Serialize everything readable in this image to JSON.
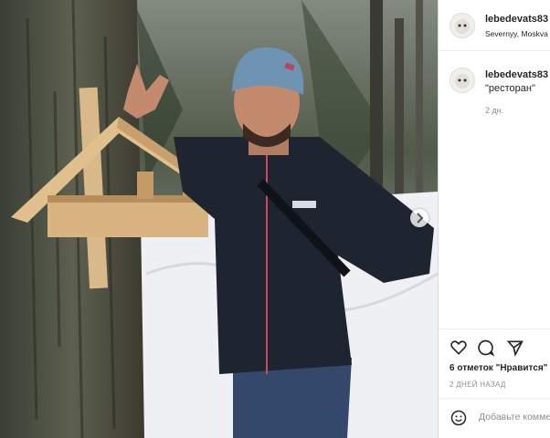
{
  "post": {
    "username": "lebedevats83",
    "location": "Severnyy, Moskva",
    "caption_user": "lebedevats83",
    "caption_text": "\"ресторан\"",
    "caption_age": "2 дн.",
    "likes": "6 отметок \"Нравится\"",
    "date": "2 ДНЕЙ НАЗАД",
    "comment_placeholder": "Добавьте комментарий..."
  },
  "icons": [
    "next-arrow-icon",
    "heart-icon",
    "comment-icon",
    "share-icon",
    "emoji-icon"
  ],
  "colors": {
    "text": "#262626",
    "muted": "#8e8e8e",
    "border": "#dbdbdb",
    "hat": "#6f93b2",
    "jacket": "#1e2430",
    "snow": "#eef0f3"
  }
}
